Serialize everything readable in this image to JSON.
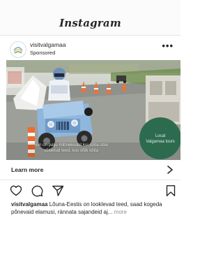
{
  "app": {
    "brand": "Instagram"
  },
  "post": {
    "username": "visitvalgamaa",
    "sponsored_label": "Sponsored",
    "more_menu": "•••",
    "media": {
      "caption_line1": "Siin on palju mitmekesist kui sõita otse",
      "caption_line2": "sõidetud teed, kus võib sõita",
      "badge_line1": "Local",
      "badge_line2": "Valgamaa tours",
      "badge_color": "#2d6b4f"
    },
    "cta": {
      "label": "Learn more",
      "icon": "chevron-right-icon"
    },
    "actions": {
      "like_icon": "heart-icon",
      "comment_icon": "comment-icon",
      "share_icon": "share-icon",
      "save_icon": "bookmark-icon"
    },
    "caption_username": "visitvalgamaa",
    "caption_text": " Lõuna-Eestis on looklevad teed, saad kogeda põnevaid elamusi, rännata sajandeid aj...",
    "caption_more": " more"
  }
}
